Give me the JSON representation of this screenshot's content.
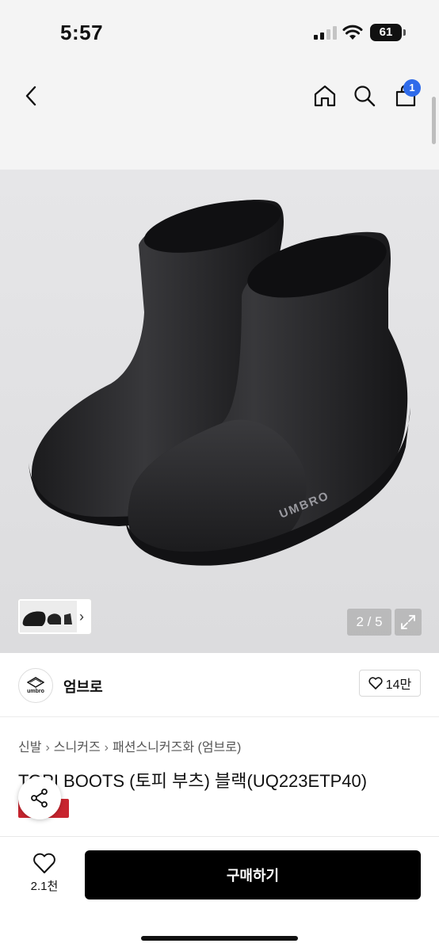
{
  "status_bar": {
    "time": "5:57",
    "battery": "61"
  },
  "nav": {
    "cart_count": "1"
  },
  "gallery": {
    "pager": "2 / 5"
  },
  "brand": {
    "name": "엄브로",
    "logo_text": "umbro",
    "likes": "14만"
  },
  "breadcrumb": [
    "신발",
    "스니커즈",
    "패션스니커즈화 (엄브로)"
  ],
  "product": {
    "title": "TOPI BOOTS (토피 부츠) 블랙(UQ223ETP40)",
    "boot_logo": "UMBRO"
  },
  "bottom": {
    "wish_count": "2.1천",
    "buy_label": "구매하기"
  },
  "icons": [
    "back-icon",
    "home-icon",
    "search-icon",
    "cart-icon",
    "chevron-right-icon",
    "expand-icon",
    "heart-icon",
    "share-icon"
  ],
  "colors": {
    "cart_badge": "#2f6bea",
    "tag_badge": "#c8252f",
    "buy_button": "#000000"
  }
}
